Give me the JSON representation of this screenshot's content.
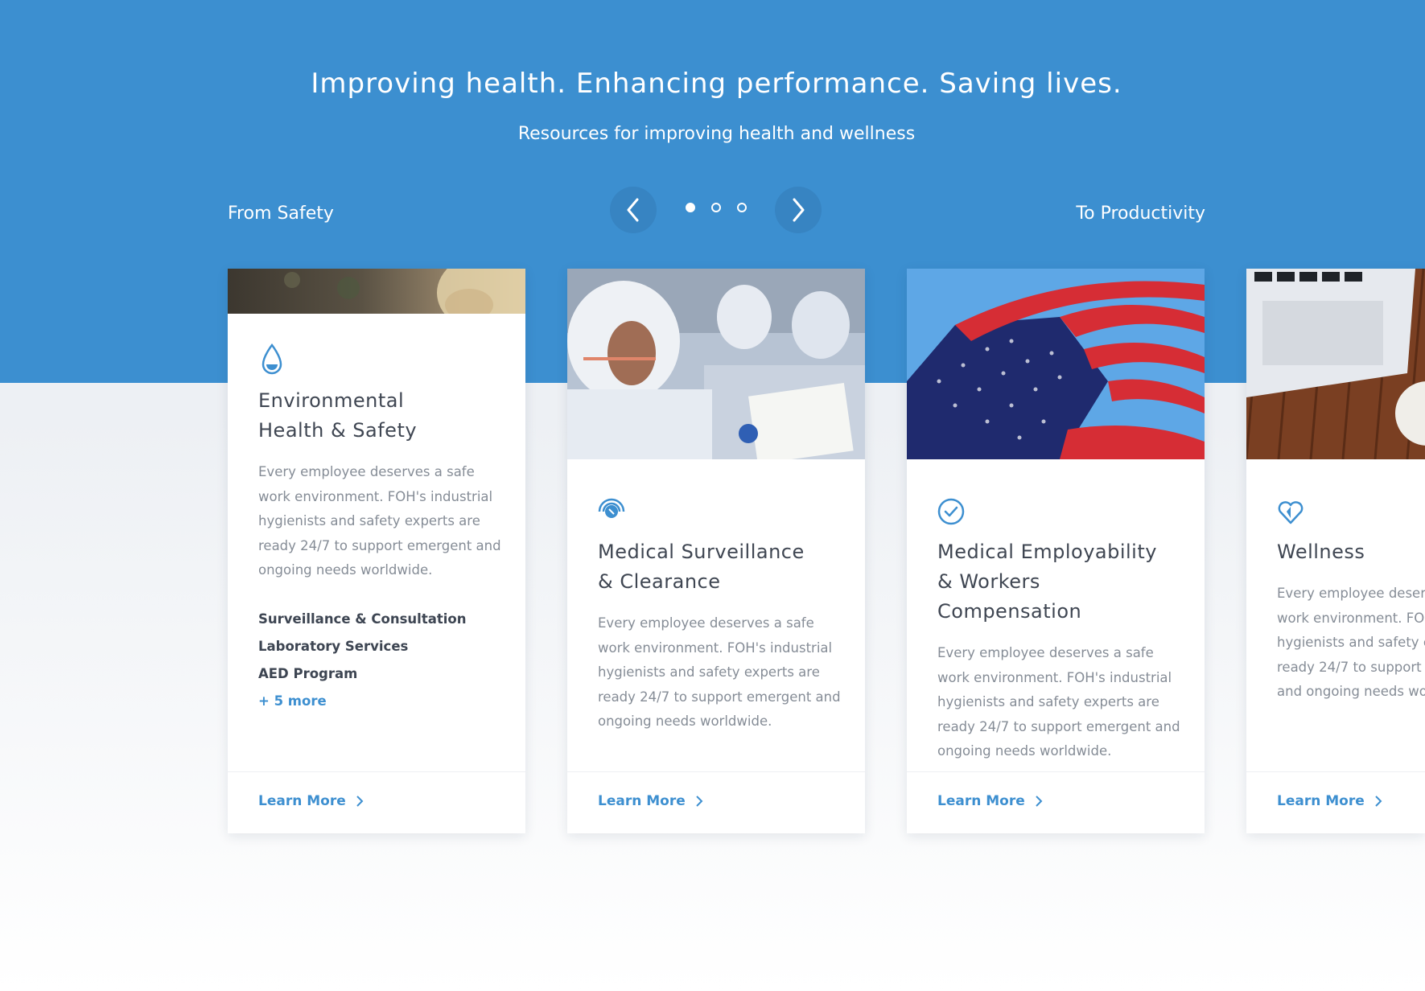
{
  "hero": {
    "headline": "Improving health. Enhancing performance. Saving lives.",
    "subhead": "Resources for improving health and wellness",
    "range_start": "From Safety",
    "range_end": "To Productivity"
  },
  "carousel": {
    "prev_icon": "chevron-left-icon",
    "next_icon": "chevron-right-icon",
    "pages": 3,
    "active_page": 1
  },
  "colors": {
    "hero_blue": "#3c8fd0",
    "accent": "#3d8fd0",
    "title_text": "#3f4652",
    "body_text": "#858c96"
  },
  "cards": [
    {
      "icon": "water-drop-icon",
      "title_line1": "Environmental",
      "title_line2": "Health & Safety",
      "description": "Every employee deserves a safe work environment. FOH's industrial hygienists and safety experts are ready 24/7 to support emergent and ongoing needs worldwide.",
      "links": [
        "Surveillance & Consultation",
        "Laboratory Services",
        "AED Program"
      ],
      "more": "+ 5 more",
      "cta": "Learn More"
    },
    {
      "icon": "radar-target-icon",
      "title_line1": "Medical Surveillance",
      "title_line2": "& Clearance",
      "description": "Every employee deserves a safe work environment. FOH's industrial hygienists and safety experts are ready 24/7 to support emergent and ongoing needs worldwide.",
      "cta": "Learn More"
    },
    {
      "icon": "check-circle-icon",
      "title_line1": "Medical Employability",
      "title_line2": "& Workers Compensation",
      "description": "Every employee deserves a safe work environment. FOH's industrial hygienists and safety experts are ready 24/7 to support emergent and ongoing needs worldwide.",
      "cta": "Learn More"
    },
    {
      "icon": "heart-icon",
      "title_line1": "Wellness",
      "description": "Every employee deserves a safe work environment. FOH's industrial hygienists and safety experts are ready 24/7 to support emergent and ongoing needs worldwide.",
      "cta": "Learn More"
    }
  ]
}
